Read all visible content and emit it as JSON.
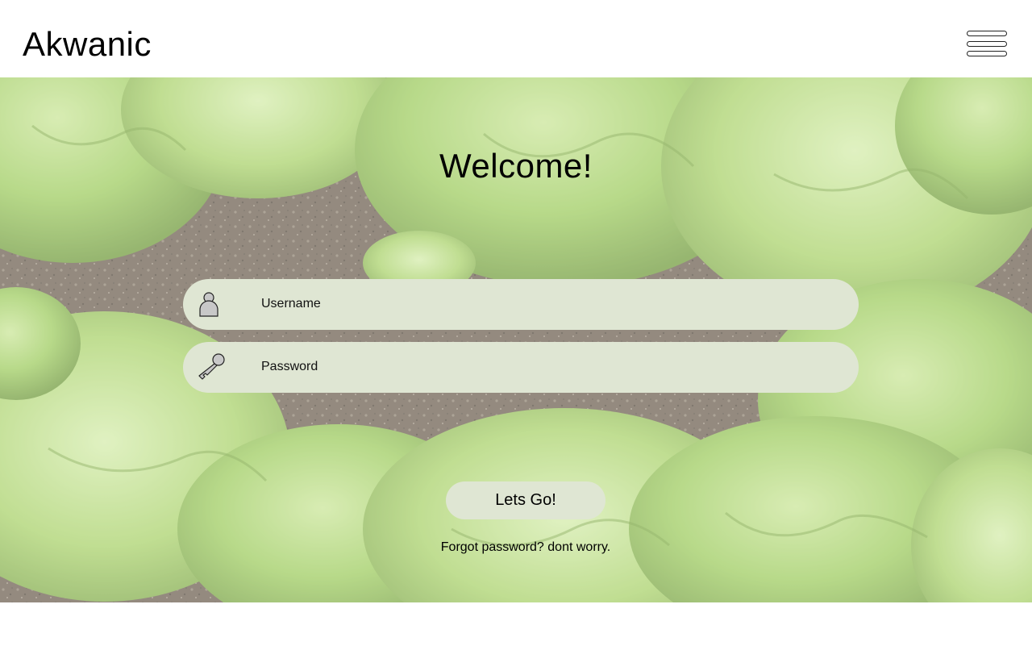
{
  "header": {
    "brand": "Akwanic",
    "menu_icon": "hamburger-menu-icon"
  },
  "hero": {
    "background": "lettuce-field-photo",
    "title": "Welcome!"
  },
  "form": {
    "username": {
      "icon": "user-icon",
      "placeholder": "Username"
    },
    "password": {
      "icon": "key-icon",
      "placeholder": "Password"
    },
    "submit_label": "Lets Go!",
    "forgot_link": "Forgot password? dont worry."
  },
  "colors": {
    "field_background": "#dfe6d3",
    "header_background": "#ffffff",
    "text": "#000000"
  }
}
